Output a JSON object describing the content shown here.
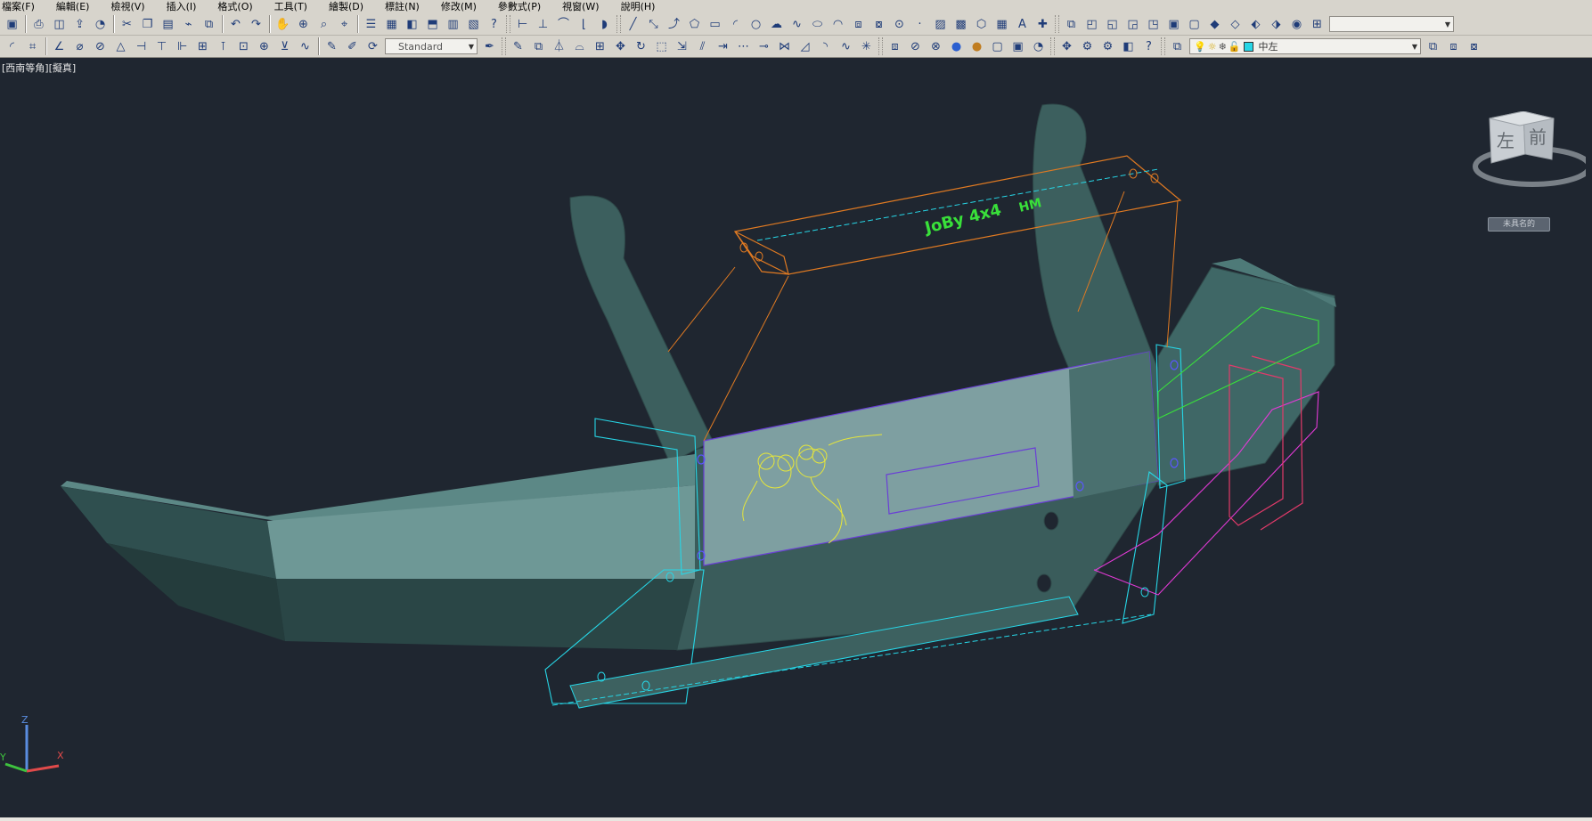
{
  "menu": [
    {
      "label": "檔案(F)"
    },
    {
      "label": "編輯(E)"
    },
    {
      "label": "檢視(V)"
    },
    {
      "label": "插入(I)"
    },
    {
      "label": "格式(O)"
    },
    {
      "label": "工具(T)"
    },
    {
      "label": "繪製(D)"
    },
    {
      "label": "標註(N)"
    },
    {
      "label": "修改(M)"
    },
    {
      "label": "參數式(P)"
    },
    {
      "label": "視窗(W)"
    },
    {
      "label": "說明(H)"
    }
  ],
  "toolbar": {
    "text_style": "Standard",
    "layer_name": "中左",
    "top_right_dropdown": ""
  },
  "viewport": {
    "label": "[西南等角][擬真]",
    "viewcube": {
      "left_face": "左",
      "front_face": "前"
    },
    "unnamed_badge": "未具名的 ",
    "logo_text": "JoBy 4x4",
    "logo_hm": "HM"
  },
  "ucs": {
    "x": "X",
    "y": "Y",
    "z": "Z"
  },
  "colors": {
    "background": "#1f2630",
    "steel": "#4d7a78",
    "panel": "#7e9fa1",
    "orange": "#e07a22",
    "cyan": "#27d6e6",
    "magenta": "#e23ad6",
    "green": "#39e03a",
    "yellow": "#e6e63a",
    "purple": "#6a3fd6"
  }
}
